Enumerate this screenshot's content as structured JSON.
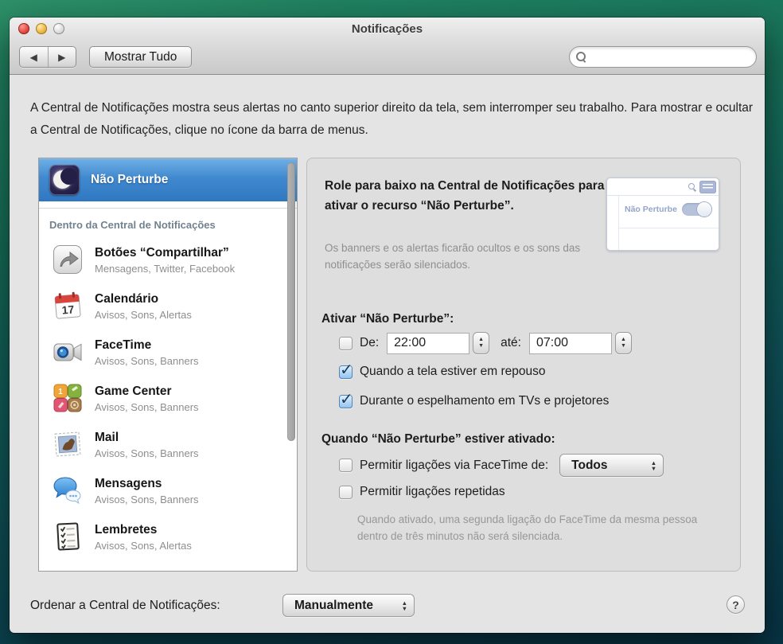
{
  "window": {
    "title": "Notificações"
  },
  "toolbar": {
    "show_all_label": "Mostrar Tudo",
    "back_glyph": "◀",
    "forward_glyph": "▶"
  },
  "intro": "A Central de Notificações mostra seus alertas no canto superior direito da tela, sem interromper seu trabalho. Para mostrar e ocultar a Central de Notificações, clique no ícone da barra de menus.",
  "sidebar": {
    "selected_label": "Não Perturbe",
    "section_header": "Dentro da Central de Notificações",
    "calendar_day": "17",
    "items": [
      {
        "title": "Botões “Compartilhar”",
        "subtitle": "Mensagens, Twitter, Facebook",
        "icon": "share-icon"
      },
      {
        "title": "Calendário",
        "subtitle": "Avisos, Sons, Alertas",
        "icon": "calendar-icon"
      },
      {
        "title": "FaceTime",
        "subtitle": "Avisos, Sons, Banners",
        "icon": "facetime-icon"
      },
      {
        "title": "Game Center",
        "subtitle": "Avisos, Sons, Banners",
        "icon": "game-center-icon"
      },
      {
        "title": "Mail",
        "subtitle": "Avisos, Sons, Banners",
        "icon": "mail-icon"
      },
      {
        "title": "Mensagens",
        "subtitle": "Avisos, Sons, Banners",
        "icon": "messages-icon"
      },
      {
        "title": "Lembretes",
        "subtitle": "Avisos, Sons, Alertas",
        "icon": "reminders-icon"
      }
    ]
  },
  "panel": {
    "heading": "Role para baixo na Central de Notificações para ativar o recurso “Não Perturbe”.",
    "subtext": "Os banners e os alertas ficarão ocultos e os sons das notificações serão silenciados.",
    "thumbnail_label": "Não Perturbe",
    "activate_label": "Ativar “Não Perturbe”:",
    "from_label": "De:",
    "from_time": "22:00",
    "to_label": "até:",
    "to_time": "07:00",
    "check_sleep_label": "Quando a tela estiver em repouso",
    "check_mirror_label": "Durante o espelhamento em TVs e projetores",
    "when_label": "Quando “Não Perturbe” estiver ativado:",
    "allow_facetime_label": "Permitir ligações via FaceTime de:",
    "facetime_from_value": "Todos",
    "allow_repeated_label": "Permitir ligações repetidas",
    "repeated_note": "Quando ativado, uma segunda ligação do FaceTime da mesma pessoa dentro de três minutos não será silenciada."
  },
  "footer": {
    "sort_label": "Ordenar a Central de Notificações:",
    "sort_value": "Manualmente",
    "help_label": "?"
  },
  "colors": {
    "selection_blue": "#3a80c6",
    "check_blue": "#173a61"
  }
}
